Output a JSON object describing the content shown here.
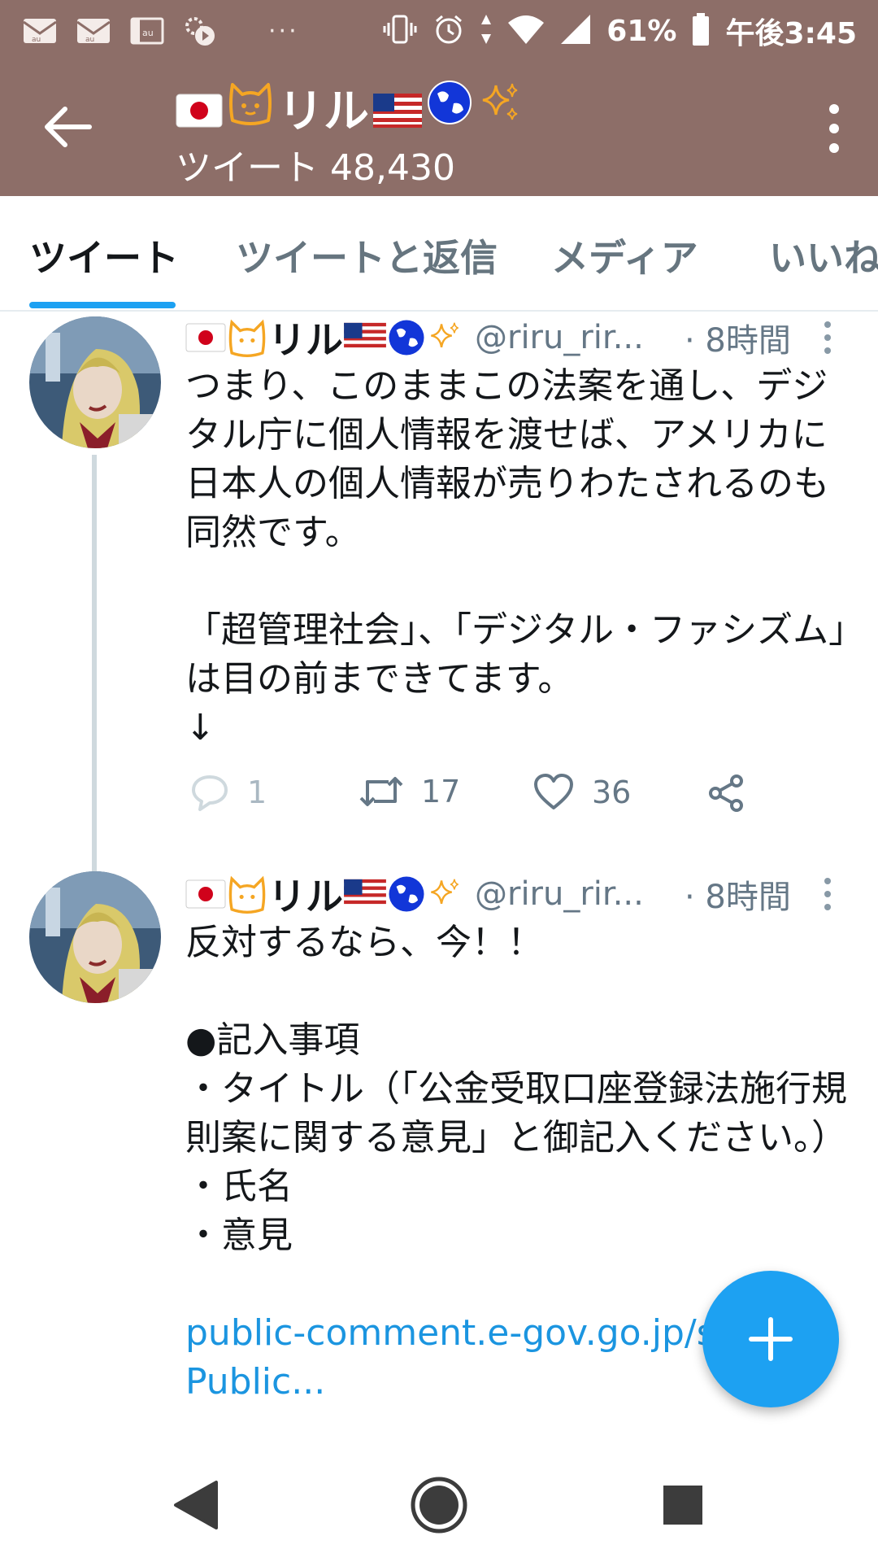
{
  "status_bar": {
    "battery_percent": "61%",
    "time": "午後3:45",
    "dots": "···",
    "left_icons": [
      "au-mail-icon",
      "au-mail-icon",
      "au-app-icon",
      "settings-cloud-icon"
    ],
    "right_icons": [
      "vibrate-icon",
      "alarm-icon",
      "data-arrows-icon",
      "wifi-icon",
      "signal-icon",
      "battery-icon"
    ]
  },
  "header": {
    "name_text": "リル",
    "subtitle": "ツイート 48,430",
    "name_decorations": [
      "japan-flag",
      "cat-face",
      "us-flag",
      "globe",
      "sparkles"
    ]
  },
  "tabs": [
    {
      "label": "ツイート",
      "active": true
    },
    {
      "label": "ツイートと返信",
      "active": false
    },
    {
      "label": "メディア",
      "active": false
    },
    {
      "label": "いいね",
      "active": false
    }
  ],
  "tweets": [
    {
      "name": "リル",
      "handle": "@riru_rir...",
      "time": "· 8時間",
      "body": [
        "つまり、このままこの法案を通し、デジタル庁に個人情報を渡せば、アメリカに日本人の個人情報が売りわたされるのも同然です。",
        "",
        "「超管理社会」、「デジタル・ファシズム」は目の前まできてます。",
        "↓"
      ],
      "replies": "1",
      "retweets": "17",
      "likes": "36"
    },
    {
      "name": "リル",
      "handle": "@riru_rir...",
      "time": "· 8時間",
      "body": [
        "反対するなら、今！！",
        "",
        "●記入事項",
        "・タイトル（「公金受取口座登録法施行規則案に関する意見」と御記入ください。）",
        "・氏名",
        "・意見",
        ""
      ],
      "link_line1": "public-comment.e-gov.go.jp/servi",
      "link_line2": "Public..."
    }
  ],
  "colors": {
    "header_bg": "#8d6e68",
    "accent": "#1da1f2",
    "link": "#1b95e0",
    "muted": "#657786"
  },
  "fab_icon": "plus-icon",
  "nav": [
    "back-triangle-icon",
    "home-circle-icon",
    "recents-square-icon"
  ]
}
